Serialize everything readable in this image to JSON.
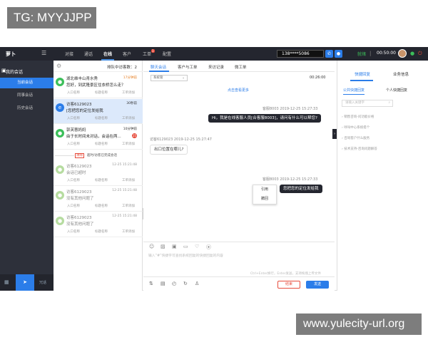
{
  "watermarks": {
    "top_left": "TG: MYYJJPP",
    "bottom_right": "www.yulecity-url.org"
  },
  "topbar": {
    "logo": "萝卜",
    "nav": [
      "对接",
      "通话",
      "在线",
      "客户",
      "工单",
      "配置"
    ],
    "active_nav": "在线",
    "badge": "1",
    "phone": "138****5086",
    "status": "就绪",
    "timer": "00:50:00"
  },
  "sidebar": {
    "title": "我的会话",
    "items": [
      "当前会话",
      "同事会话",
      "历史会话"
    ],
    "active": "当前会话",
    "bottom_label": "冗话"
  },
  "conversation_list": {
    "queue_text": "排队中访客数：2",
    "items": [
      {
        "name": "湖北维丰山青水秀",
        "message": "您好，到武隆景区住衣桥怎么走？",
        "time": "17分钟前",
        "sub": [
          "入口名称",
          "标题名称",
          "工单添加"
        ],
        "avatar_color": "#3cbf5a",
        "state": "normal"
      },
      {
        "name": "访客6129023",
        "message": "[您把您的定位发给我",
        "time": "30秒前",
        "sub": [
          "入口名称",
          "标题名称",
          "工单添加"
        ],
        "avatar_color": "#2b7de9",
        "state": "selected"
      },
      {
        "name": "郭芙蓉妈妈",
        "message": "由于长时间未对话，会话在两...",
        "time": "10分钟前",
        "sub": [
          "入口名称",
          "标题名称",
          "工单添加"
        ],
        "avatar_color": "#3cbf5a",
        "state": "normal",
        "unread": "25"
      },
      {
        "name": "访客6129023",
        "message": "会话已超时",
        "time": "12-25 15:21:48",
        "sub": [
          "入口名称",
          "标题名称",
          "工单添加"
        ],
        "avatar_color": "#b6dca0",
        "state": "faded"
      },
      {
        "name": "访客6129023",
        "message": "没有其他问题了",
        "time": "12-25 15:21:48",
        "sub": [
          "入口名称",
          "标题名称",
          "工单添加"
        ],
        "avatar_color": "#b6dca0",
        "state": "faded"
      },
      {
        "name": "访客6129023",
        "message": "没有其他问题了",
        "time": "12-25 15:21:48",
        "sub": [
          "入口名称",
          "标题名称",
          "工单添加"
        ],
        "avatar_color": "#b6dca0",
        "state": "faded"
      }
    ],
    "divider": {
      "tag": "清除",
      "text": "超时/访客已完成会话"
    }
  },
  "chat": {
    "tabs": [
      "聊天会话",
      "客户与工单",
      "来访记录",
      "微工单"
    ],
    "active_tab": "聊天会话",
    "select_value": "系统管",
    "top_time": "00:26:00",
    "load_more": "点击查看更多",
    "messages": [
      {
        "meta": "客服8003 2019-12-25 15:27:33",
        "text": "Hi，我是在线客服人员[合客服8003]，请问有什么可以帮您?",
        "side": "right"
      },
      {
        "meta": "访客6129023 2019-12-25 15:27:47",
        "text": "出口位置在哪儿?",
        "side": "left"
      },
      {
        "meta": "客服8003 2019-12-25 15:27:33",
        "text": "您把您的定位发给我",
        "side": "right"
      }
    ],
    "context_menu": [
      "引用",
      "撤回"
    ],
    "input_placeholder": "输入“#”快捷字可查找系统回复的快捷回复的内容",
    "input_hint": "Ctrl+Enter换行，Enter发送，支持拖拽上传文件",
    "cancel_label": "结束",
    "send_label": "发送"
  },
  "right_panel": {
    "tabs": [
      "快捷回复",
      "业务信息"
    ],
    "active_tab": "快捷回复",
    "sub_tabs": [
      "公共快捷回复",
      "个人快捷回复"
    ],
    "active_sub": "公共快捷回复",
    "search_placeholder": "请输入关键字",
    "items": [
      "销售咨询-问功能价格",
      "呼叫中心系统搭个",
      "咨询客户什么服务",
      "技术支持-咨询问题解答"
    ]
  },
  "colors": {
    "accent": "#2b7de9",
    "dark": "#24262f",
    "danger": "#e74c3c"
  }
}
